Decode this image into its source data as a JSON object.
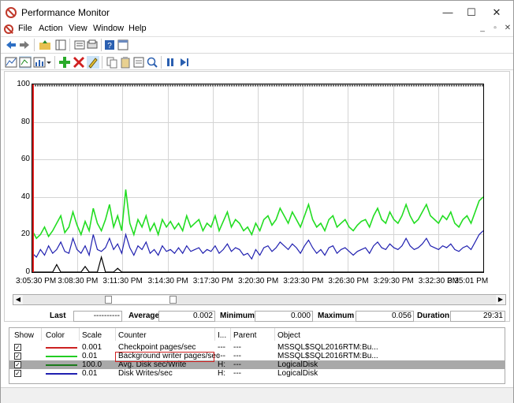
{
  "window": {
    "title": "Performance Monitor",
    "min": "—",
    "max": "☐",
    "close": "✕"
  },
  "menu": [
    "File",
    "Action",
    "View",
    "Window",
    "Help"
  ],
  "mdi": {
    "min": "_",
    "restore": "▫",
    "close": "✕"
  },
  "icons": {
    "toolbar1": [
      "back-arrow-icon",
      "forward-arrow-icon",
      "up-folder-icon",
      "show-hide-tree-icon",
      "properties-icon",
      "help-icon",
      "console-tree-icon"
    ],
    "toolbar2": [
      "view-current-activity-icon",
      "change-graph-type-icon",
      "dropdown-icon",
      "add-counter-icon",
      "delete-counter-icon",
      "highlight-icon",
      "copy-properties-icon",
      "paste-counter-list-icon",
      "properties-icon",
      "zoom-icon",
      "freeze-display-icon",
      "update-data-icon"
    ]
  },
  "chart_data": {
    "type": "line",
    "ylim": [
      0,
      100
    ],
    "yticks": [
      "100",
      "80",
      "60",
      "40",
      "20",
      "0"
    ],
    "xticks": [
      "3:05:30 PM",
      "3:08:30 PM",
      "3:11:30 PM",
      "3:14:30 PM",
      "3:17:30 PM",
      "3:20:30 PM",
      "3:23:30 PM",
      "3:26:30 PM",
      "3:29:30 PM",
      "3:32:30 PM",
      "3:35:01 PM"
    ],
    "series": [
      {
        "name": "Background writer pages/sec",
        "color": "#22dd22",
        "values": [
          22,
          18,
          20,
          24,
          19,
          22,
          26,
          30,
          21,
          24,
          32,
          25,
          20,
          27,
          22,
          34,
          26,
          22,
          28,
          36,
          24,
          30,
          22,
          44,
          26,
          20,
          28,
          24,
          30,
          22,
          26,
          20,
          28,
          24,
          27,
          23,
          26,
          22,
          30,
          24,
          26,
          28,
          22,
          26,
          24,
          30,
          22,
          27,
          32,
          24,
          28,
          26,
          22,
          24,
          20,
          26,
          22,
          28,
          30,
          25,
          28,
          34,
          30,
          26,
          32,
          28,
          24,
          30,
          36,
          28,
          24,
          26,
          22,
          28,
          30,
          24,
          26,
          28,
          24,
          22,
          25,
          27,
          28,
          24,
          30,
          34,
          28,
          26,
          32,
          28,
          26,
          30,
          36,
          30,
          26,
          28,
          32,
          36,
          30,
          28,
          26,
          30,
          28,
          32,
          26,
          24,
          28,
          30,
          26,
          32,
          38,
          40
        ]
      },
      {
        "name": "Disk Writes/sec",
        "color": "#2020b0",
        "values": [
          10,
          8,
          12,
          9,
          14,
          10,
          12,
          16,
          11,
          10,
          18,
          12,
          10,
          14,
          9,
          20,
          12,
          11,
          13,
          18,
          12,
          15,
          10,
          20,
          13,
          9,
          14,
          12,
          16,
          10,
          12,
          9,
          14,
          11,
          12,
          10,
          13,
          10,
          14,
          11,
          12,
          13,
          10,
          12,
          11,
          14,
          10,
          12,
          15,
          11,
          13,
          12,
          9,
          10,
          7,
          12,
          9,
          13,
          14,
          11,
          13,
          16,
          14,
          12,
          15,
          13,
          10,
          14,
          17,
          13,
          10,
          12,
          9,
          13,
          14,
          10,
          12,
          13,
          11,
          9,
          11,
          12,
          13,
          10,
          14,
          16,
          13,
          12,
          15,
          13,
          12,
          14,
          18,
          14,
          12,
          13,
          15,
          18,
          14,
          13,
          12,
          14,
          13,
          15,
          12,
          11,
          13,
          14,
          12,
          16,
          20,
          22
        ]
      },
      {
        "name": "Checkpoint pages/sec",
        "color": "#000000",
        "values": [
          0,
          0,
          0,
          0,
          0,
          0,
          4,
          0,
          0,
          0,
          0,
          0,
          0,
          3,
          0,
          0,
          0,
          8,
          0,
          0,
          0,
          2,
          0,
          0,
          0,
          0,
          0,
          0,
          0,
          0,
          0,
          0,
          0,
          0,
          0,
          0,
          0,
          0,
          0,
          0,
          0,
          0,
          0,
          0,
          0,
          0,
          0,
          0,
          0,
          0,
          0,
          0,
          0,
          0,
          0,
          0,
          0,
          0,
          0,
          0,
          0,
          0,
          0,
          0,
          0,
          0,
          0,
          0,
          0,
          0,
          0,
          0,
          0,
          0,
          0,
          0,
          0,
          0,
          0,
          0,
          0,
          0,
          0,
          0,
          0,
          0,
          0,
          0,
          0,
          0,
          0,
          0,
          0,
          0,
          0,
          0,
          0,
          0,
          0,
          0,
          0,
          0,
          0,
          0,
          0,
          0,
          0,
          0,
          0,
          0,
          0,
          0
        ]
      }
    ]
  },
  "stats": {
    "last_label": "Last",
    "last": "----------",
    "average_label": "Average",
    "average": "0.002",
    "minimum_label": "Minimum",
    "minimum": "0.000",
    "maximum_label": "Maximum",
    "maximum": "0.056",
    "duration_label": "Duration",
    "duration": "29:31"
  },
  "list": {
    "headers": {
      "show": "Show",
      "color": "Color",
      "scale": "Scale",
      "counter": "Counter",
      "instance": "I...",
      "parent": "Parent",
      "object": "Object"
    },
    "rows": [
      {
        "check": "✓",
        "color": "#cc2222",
        "scale": "0.001",
        "counter": "Checkpoint pages/sec",
        "instance": "---",
        "parent": "---",
        "object": "MSSQL$SQL2016RTM:Bu..."
      },
      {
        "check": "✓",
        "color": "#22cc22",
        "scale": "0.01",
        "counter": "Background writer pages/sec",
        "instance": "---",
        "parent": "---",
        "object": "MSSQL$SQL2016RTM:Bu..."
      },
      {
        "check": "✓",
        "color": "#1a7a1a",
        "scale": "100.0",
        "counter": "Avg. Disk sec/Write",
        "instance": "H:",
        "parent": "---",
        "object": "LogicalDisk"
      },
      {
        "check": "✓",
        "color": "#2020b0",
        "scale": "0.01",
        "counter": "Disk Writes/sec",
        "instance": "H:",
        "parent": "---",
        "object": "LogicalDisk"
      }
    ]
  }
}
